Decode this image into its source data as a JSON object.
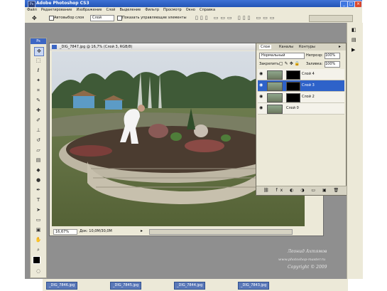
{
  "window": {
    "title": "Adobe Photoshop CS3",
    "icon": "Ps"
  },
  "menu": [
    "Файл",
    "Редактирование",
    "Изображение",
    "Слой",
    "Выделение",
    "Фильтр",
    "Просмотр",
    "Окно",
    "Справка"
  ],
  "options": {
    "autoselect_label": "Автовыбор слоя",
    "autoselect_value": "Слой",
    "show_controls_label": "Показать управляющие элементы"
  },
  "document": {
    "title": "_DIG_7847.jpg @ 16,7% (Слой 3, RGB/8)",
    "zoom": "16,67%",
    "doc_info": "Док: 10,0М/30,0М"
  },
  "layers_panel": {
    "tabs": [
      "Слои",
      "Каналы",
      "Контуры"
    ],
    "blend_mode": "Нормальный",
    "opacity_label": "Непрозр:",
    "opacity_value": "100%",
    "lock_label": "Закрепить:",
    "fill_label": "Заливка:",
    "fill_value": "100%",
    "layers": [
      {
        "name": "Слой 4",
        "selected": false,
        "has_mask": true
      },
      {
        "name": "Слой 3",
        "selected": true,
        "has_mask": true
      },
      {
        "name": "Слой 2",
        "selected": false,
        "has_mask": true
      },
      {
        "name": "Слой 0",
        "selected": false,
        "has_mask": false
      }
    ]
  },
  "credits": {
    "author": "Леонид Ахтямов",
    "site": "www.photoshop-master.ru",
    "copyright": "Copyright © 2009"
  },
  "taskbar": {
    "items": [
      "_DIG_7846.jpg",
      "_DIG_7845.jpg",
      "_DIG_7844.jpg",
      "_DIG_7843.jpg"
    ]
  },
  "colors": {
    "title_blue": "#2f62c8",
    "selected_layer": "#2e62c9",
    "workspace_gray": "#8f8f8f"
  }
}
